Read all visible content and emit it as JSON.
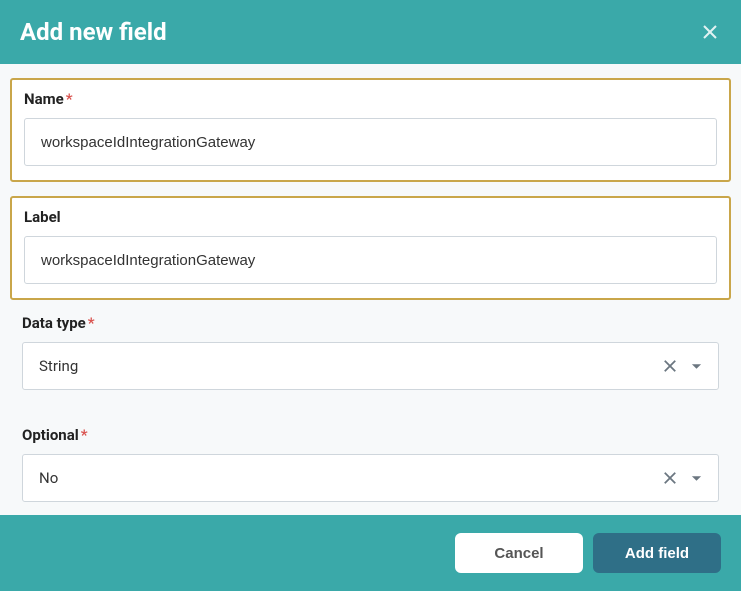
{
  "header": {
    "title": "Add new field"
  },
  "fields": {
    "name": {
      "label": "Name",
      "required": "*",
      "value": "workspaceIdIntegrationGateway"
    },
    "label": {
      "label": "Label",
      "value": "workspaceIdIntegrationGateway"
    },
    "dataType": {
      "label": "Data type",
      "required": "*",
      "value": "String"
    },
    "optional": {
      "label": "Optional",
      "required": "*",
      "value": "No"
    }
  },
  "footer": {
    "cancel": "Cancel",
    "submit": "Add field"
  }
}
